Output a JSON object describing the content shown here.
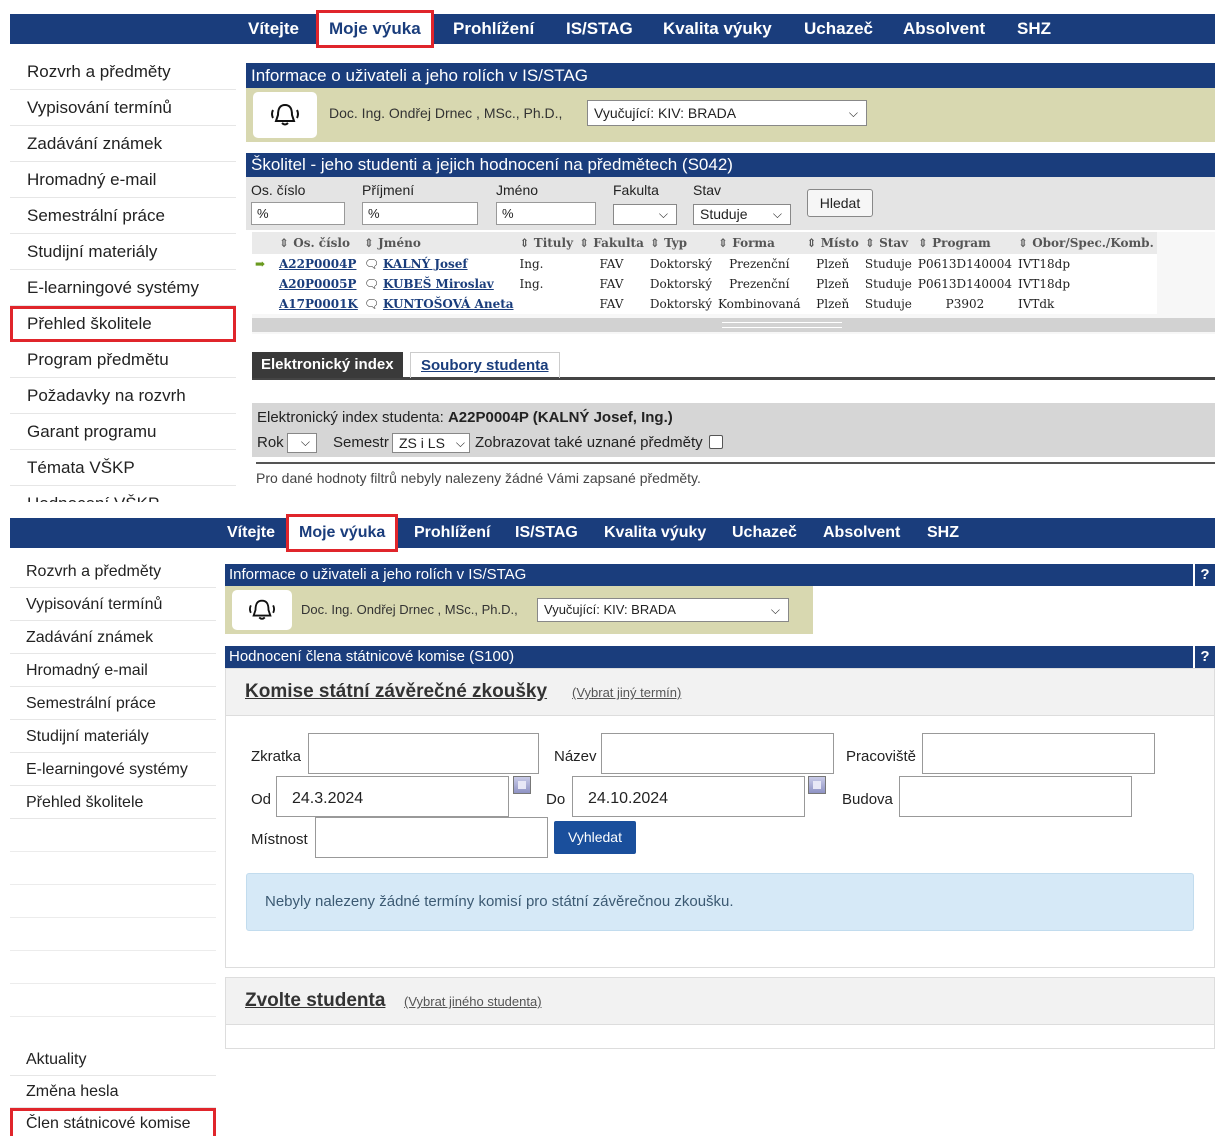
{
  "nav": [
    "Vítejte",
    "Moje výuka",
    "Prohlížení",
    "IS/STAG",
    "Kvalita výuky",
    "Uchazeč",
    "Absolvent",
    "SHZ"
  ],
  "panel1": {
    "sidebar": [
      "Rozvrh a předměty",
      "Vypisování termínů",
      "Zadávání známek",
      "Hromadný e-mail",
      "Semestrální práce",
      "Studijní materiály",
      "E-learningové systémy",
      "Přehled školitele",
      "Program předmětu",
      "Požadavky na rozvrh",
      "Garant programu",
      "Témata VŠKP",
      "Hodnocení VŠKP"
    ],
    "info_title": "Informace o uživateli a jeho rolích v IS/STAG",
    "user": "Doc. Ing. Ondřej Drnec , MSc., Ph.D.,",
    "role": "Vyučující: KIV: BRADA",
    "section_title": "Školitel - jeho studenti a jejich hodnocení na předmětech (S042)",
    "filters": {
      "os": "Os. číslo",
      "prijmeni": "Příjmení",
      "jmeno": "Jméno",
      "fakulta": "Fakulta",
      "stav": "Stav",
      "os_val": "%",
      "prijmeni_val": "%",
      "jmeno_val": "%",
      "stav_val": "Studuje",
      "search": "Hledat"
    },
    "columns": [
      "Os. číslo",
      "Jméno",
      "Tituly",
      "Fakulta",
      "Typ",
      "Forma",
      "Místo",
      "Stav",
      "Program",
      "Obor/Spec./Komb."
    ],
    "rows": [
      {
        "os": "A22P0004P",
        "jmeno": "KALNÝ Josef",
        "tituly": "Ing.",
        "fakulta": "FAV",
        "typ": "Doktorský",
        "forma": "Prezenční",
        "misto": "Plzeň",
        "stav": "Studuje",
        "program": "P0613D140004",
        "obor": "IVT18dp"
      },
      {
        "os": "A20P0005P",
        "jmeno": "KUBEŠ Miroslav",
        "tituly": "Ing.",
        "fakulta": "FAV",
        "typ": "Doktorský",
        "forma": "Prezenční",
        "misto": "Plzeň",
        "stav": "Studuje",
        "program": "P0613D140004",
        "obor": "IVT18dp"
      },
      {
        "os": "A17P0001K",
        "jmeno": "KUNTOŠOVÁ Aneta",
        "tituly": "",
        "fakulta": "FAV",
        "typ": "Doktorský",
        "forma": "Kombinovaná",
        "misto": "Plzeň",
        "stav": "Studuje",
        "program": "P3902",
        "obor": "IVTdk"
      }
    ],
    "tabs": [
      "Elektronický index",
      "Soubory studenta"
    ],
    "index_label": "Elektronický index studenta:",
    "index_student": "A22P0004P (KALNÝ Josef, Ing.)",
    "rok_label": "Rok",
    "semestr_label": "Semestr",
    "semestr_val": "ZS i LS",
    "uznane_label": "Zobrazovat také uznané předměty",
    "empty_msg": "Pro dané hodnoty filtrů nebyly nalezeny žádné Vámi zapsané předměty."
  },
  "panel2": {
    "sidebar": [
      "Rozvrh a předměty",
      "Vypisování termínů",
      "Zadávání známek",
      "Hromadný e-mail",
      "Semestrální práce",
      "Studijní materiály",
      "E-learningové systémy",
      "Přehled školitele"
    ],
    "sidebar_bottom": [
      "Aktuality",
      "Změna hesla",
      "Člen státnicové komise"
    ],
    "info_title": "Informace o uživateli a jeho rolích v IS/STAG",
    "user": "Doc. Ing. Ondřej Drnec , MSc., Ph.D.,",
    "role": "Vyučující: KIV: BRADA",
    "section_title": "Hodnocení člena státnicové komise (S100)",
    "help": "?",
    "komise_title": "Komise státní závěrečné zkoušky",
    "komise_link": "(Vybrat jiný termín)",
    "form": {
      "zkratka": "Zkratka",
      "nazev": "Název",
      "pracoviste": "Pracoviště",
      "od": "Od",
      "od_val": "24.3.2024",
      "do": "Do",
      "do_val": "24.10.2024",
      "budova": "Budova",
      "mistnost": "Místnost",
      "search": "Vyhledat"
    },
    "alert": "Nebyly nalezeny žádné termíny komisí pro státní závěrečnou zkoušku.",
    "student_title": "Zvolte studenta",
    "student_link": "(Vybrat jiného studenta)"
  }
}
